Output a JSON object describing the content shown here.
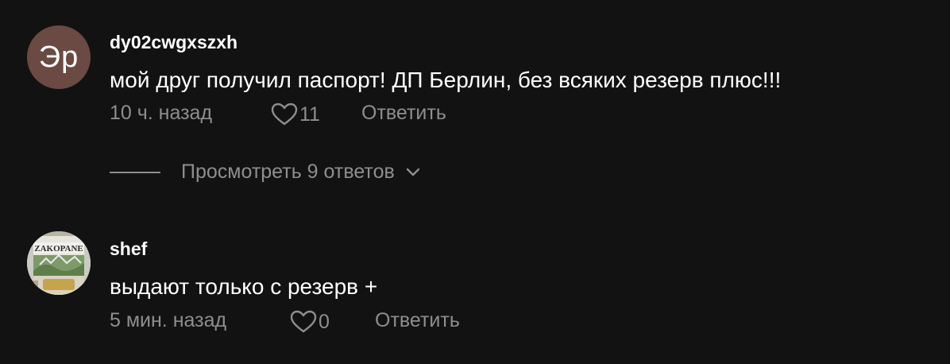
{
  "comments": [
    {
      "avatar_initials": "Эр",
      "username": "dy02cwgxszxh",
      "text": "мой друг получил паспорт! ДП Берлин, без всяких резерв плюс!!!",
      "time": "10 ч. назад",
      "likes": "11",
      "reply_label": "Ответить",
      "view_replies_label": "Просмотреть 9 ответов"
    },
    {
      "avatar_text": "ZAKOPANE",
      "username": "shef",
      "text": "выдают только с резерв +",
      "time": "5 мин. назад",
      "likes": "0",
      "reply_label": "Ответить"
    }
  ],
  "colors": {
    "background": "#121212",
    "primary_text": "#ffffff",
    "secondary_text": "#8e8e8e",
    "avatar_initials_bg": "#6b4a43"
  },
  "icons": {
    "like": "heart-outline-icon",
    "expand": "chevron-down-icon"
  }
}
